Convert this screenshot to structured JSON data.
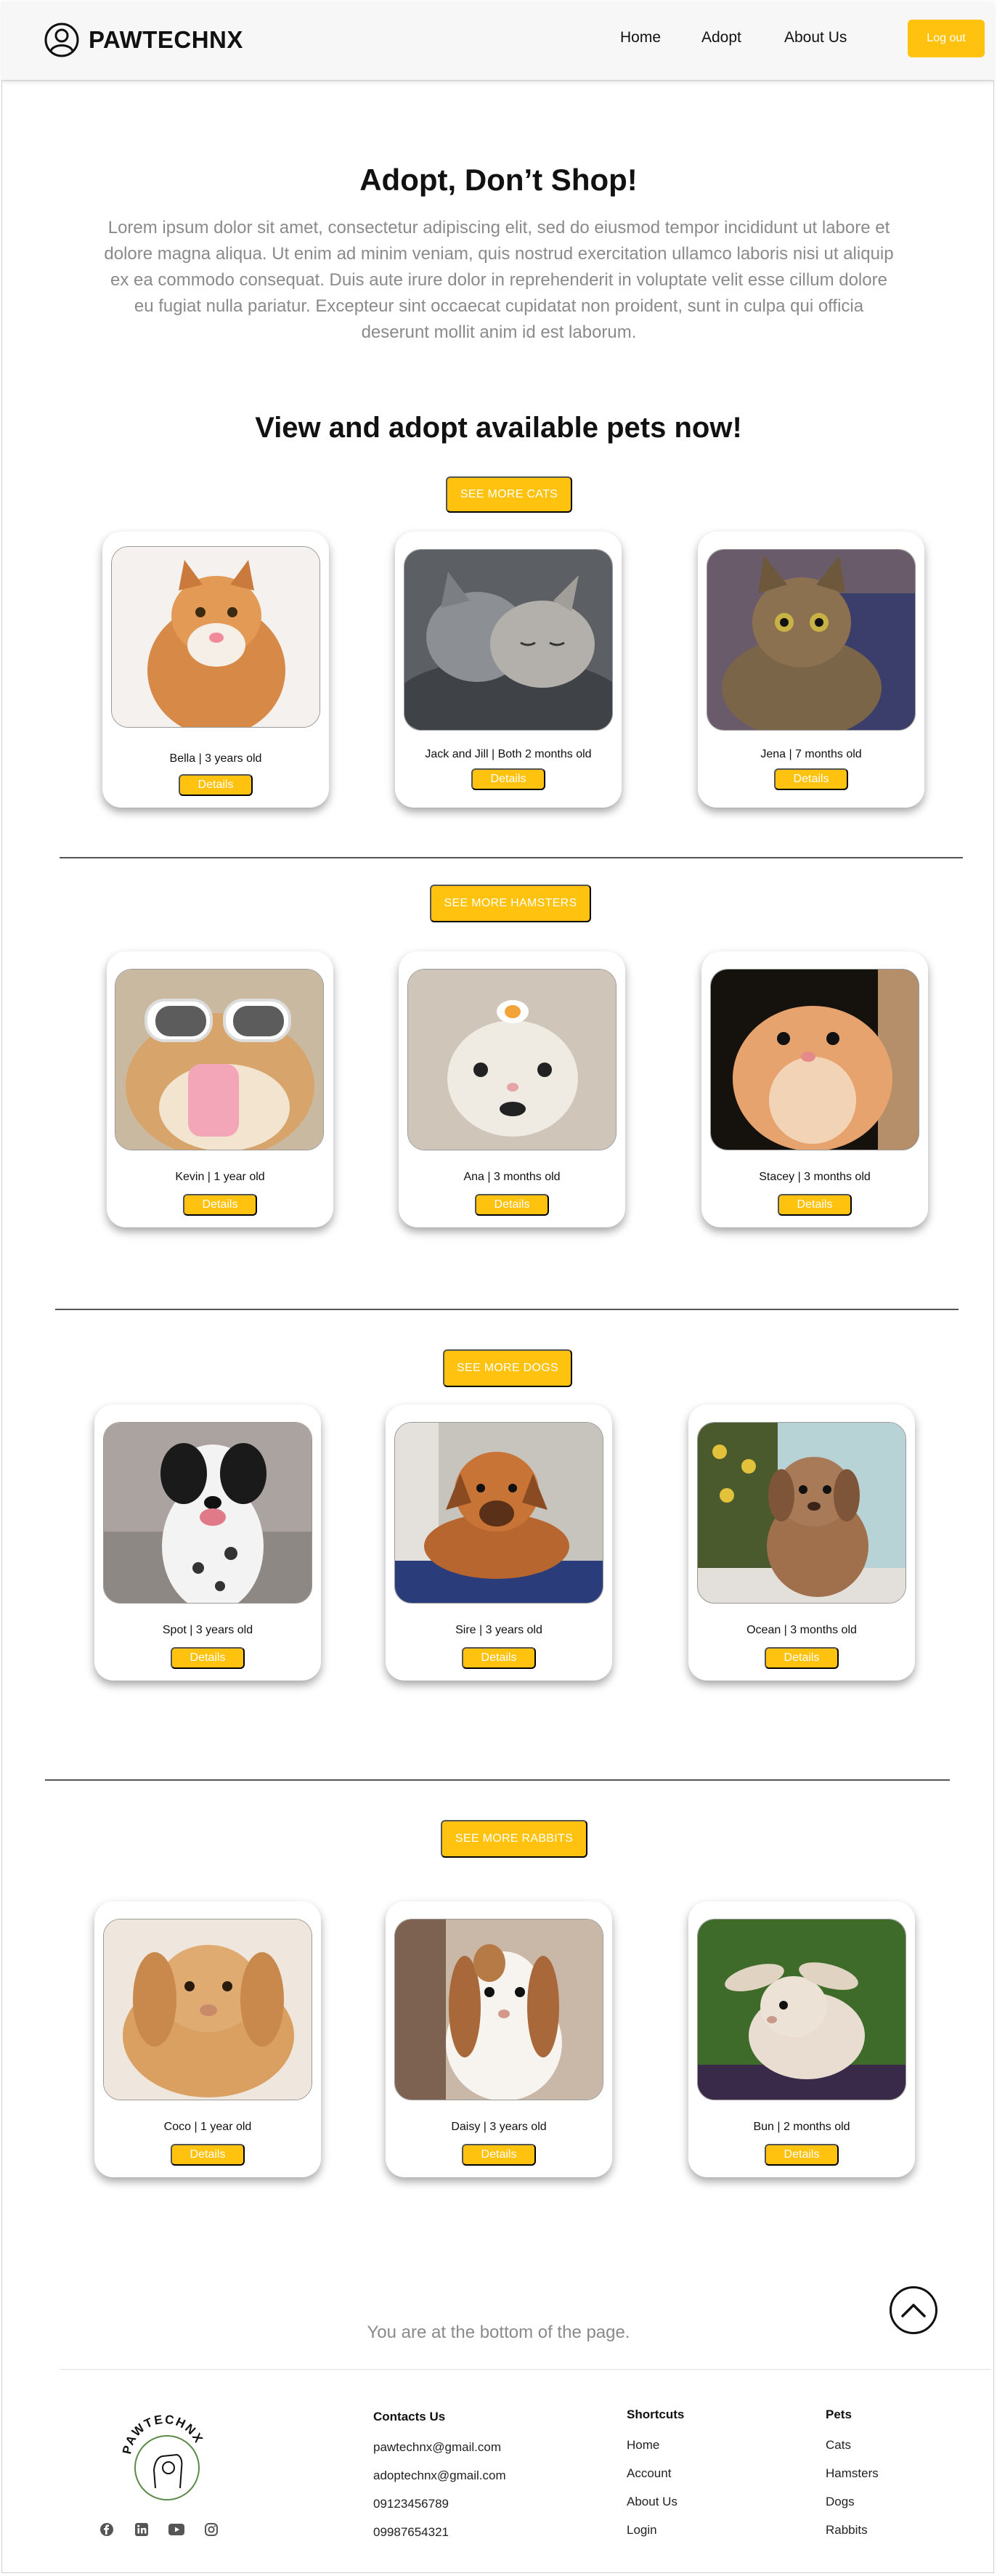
{
  "header": {
    "brand": "PAWTECHNX",
    "nav": [
      "Home",
      "Adopt",
      "About Us"
    ],
    "logout": "Log out"
  },
  "hero": {
    "title": "Adopt, Don’t Shop!",
    "text": "Lorem ipsum dolor sit amet, consectetur adipiscing elit, sed do eiusmod tempor incididunt ut labore et dolore magna aliqua. Ut enim ad minim veniam, quis nostrud exercitation ullamco laboris nisi ut aliquip ex ea commodo consequat. Duis aute irure dolor in reprehenderit in voluptate velit esse cillum dolore eu fugiat nulla pariatur. Excepteur sint occaecat cupidatat non proident, sunt in culpa qui officia deserunt mollit anim id est laborum."
  },
  "section_title": "View and adopt available pets now!",
  "details_label": "Details",
  "groups": [
    {
      "button": "SEE MORE CATS",
      "pets": [
        {
          "caption": "Bella | 3 years old",
          "photo": "orange-cat-photo"
        },
        {
          "caption": "Jack and Jill | Both 2 months old",
          "photo": "grey-kittens-photo"
        },
        {
          "caption": "Jena | 7 months old",
          "photo": "tabby-cat-photo"
        }
      ]
    },
    {
      "button": "SEE MORE HAMSTERS",
      "pets": [
        {
          "caption": "Kevin | 1 year old",
          "photo": "hamster-sunglasses-photo"
        },
        {
          "caption": "Ana | 3 months old",
          "photo": "white-hamster-photo"
        },
        {
          "caption": "Stacey | 3 months old",
          "photo": "orange-hamster-photo"
        }
      ]
    },
    {
      "button": "SEE MORE DOGS",
      "pets": [
        {
          "caption": "Spot | 3 years old",
          "photo": "spotted-dog-photo"
        },
        {
          "caption": "Sire | 3 years old",
          "photo": "brown-puppy-photo"
        },
        {
          "caption": "Ocean | 3 months old",
          "photo": "light-brown-puppy-photo"
        }
      ]
    },
    {
      "button": "SEE MORE RABBITS",
      "pets": [
        {
          "caption": "Coco | 1 year old",
          "photo": "tan-rabbit-photo"
        },
        {
          "caption": "Daisy | 3 years old",
          "photo": "white-brown-rabbit-photo"
        },
        {
          "caption": "Bun | 2 months old",
          "photo": "cream-rabbit-photo"
        }
      ]
    }
  ],
  "bottom_text": "You are at the bottom of the page.",
  "footer": {
    "logo_text": "PAWTECHNX",
    "contacts": {
      "head": "Contacts Us",
      "items": [
        "pawtechnx@gmail.com",
        "adoptechnx@gmail.com",
        "09123456789",
        "09987654321"
      ]
    },
    "shortcuts": {
      "head": "Shortcuts",
      "items": [
        "Home",
        "Account",
        "About Us",
        "Login"
      ]
    },
    "pets": {
      "head": "Pets",
      "items": [
        "Cats",
        "Hamsters",
        "Dogs",
        "Rabbits"
      ]
    },
    "social": [
      "facebook-icon",
      "linkedin-icon",
      "youtube-icon",
      "instagram-icon"
    ]
  },
  "colors": {
    "accent": "#ffc20e",
    "muted_text": "#8a8a8a"
  }
}
